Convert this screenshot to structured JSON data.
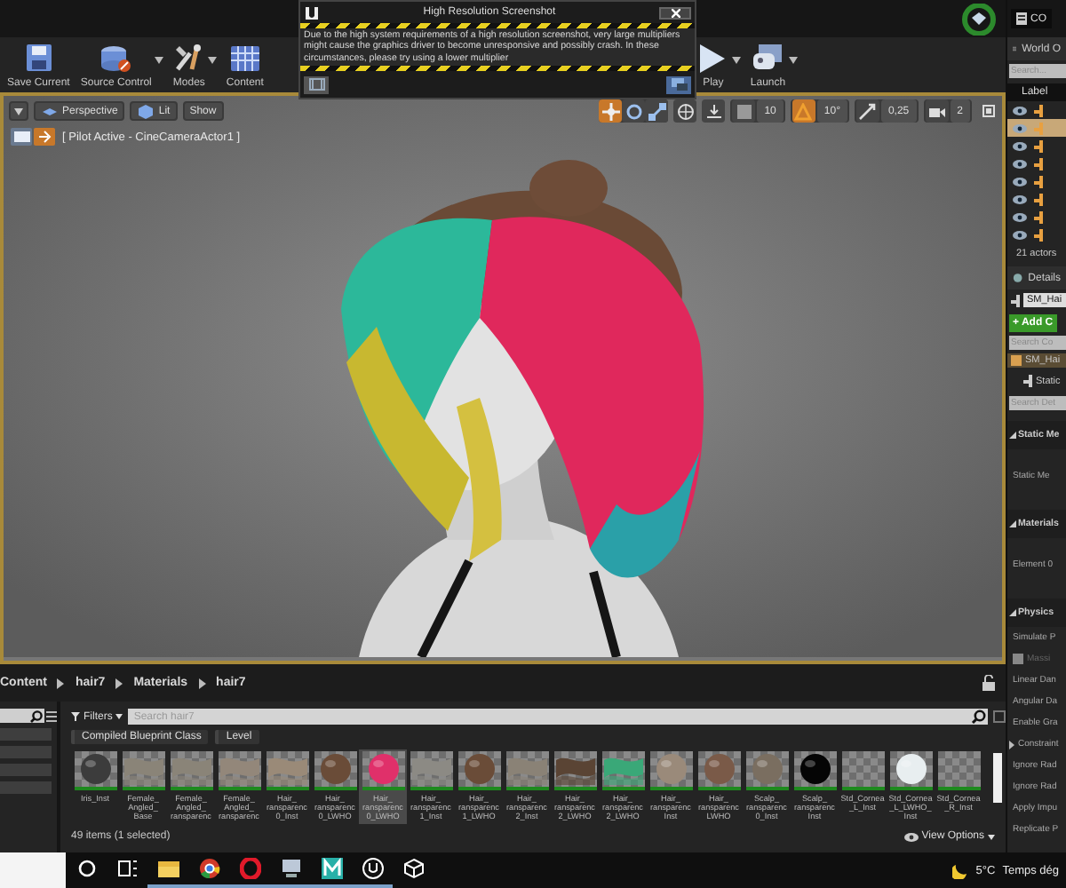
{
  "toolbar": {
    "buttons": [
      {
        "label": "Save Current",
        "kind": "save",
        "dropdown": false
      },
      {
        "label": "Source Control",
        "kind": "source",
        "dropdown": true
      },
      {
        "label": "Modes",
        "kind": "modes",
        "dropdown": true
      },
      {
        "label": "Content",
        "kind": "content",
        "dropdown": false
      },
      {
        "label": "Play",
        "kind": "play",
        "dropdown": true
      },
      {
        "label": "Launch",
        "kind": "launch",
        "dropdown": true
      }
    ]
  },
  "dialog": {
    "title": "High Resolution Screenshot",
    "message": "Due to the high system requirements of a high resolution screenshot, very large multipliers might cause the graphics driver to become unresponsive and possibly crash. In these circumstances, please try using a lower multiplier"
  },
  "viewport": {
    "view_buttons": [
      {
        "label": "Perspective",
        "kind": "perspective"
      },
      {
        "label": "Lit",
        "kind": "lit"
      },
      {
        "label": "Show",
        "kind": "plain"
      }
    ],
    "pilot_label": "[ Pilot Active - CineCameraActor1 ]",
    "transform_tools": [
      {
        "kind": "translate",
        "selected": true
      },
      {
        "kind": "rotate",
        "selected": false
      },
      {
        "kind": "scale",
        "selected": false
      }
    ],
    "snaps": [
      {
        "kind": "grid",
        "value": "10",
        "active": false
      },
      {
        "kind": "rotation",
        "value": "10°",
        "active": true
      },
      {
        "kind": "scale",
        "value": "0,25",
        "active": false
      },
      {
        "kind": "speed",
        "value": "2",
        "active": false
      }
    ]
  },
  "right_panel": {
    "tab": "CO",
    "world_outliner": {
      "title": "World O",
      "search_placeholder": "Search...",
      "column": "Label",
      "rows": [
        {
          "selected": false
        },
        {
          "selected": true
        },
        {
          "selected": false
        },
        {
          "selected": false
        },
        {
          "selected": false
        },
        {
          "selected": false
        },
        {
          "selected": false
        },
        {
          "selected": false
        }
      ],
      "actor_count": "21 actors"
    },
    "details": {
      "title": "Details",
      "actor_name": "SM_Hai",
      "add_button": "+ Add C",
      "component_search_placeholder": "Search Co",
      "component": "SM_Hai",
      "sub_component": "Static",
      "search_placeholder": "Search Det",
      "sections": [
        {
          "title": "Static Me",
          "rows": [
            {
              "kind": "tall",
              "label": "Static Me"
            }
          ]
        },
        {
          "title": "Materials",
          "rows": [
            {
              "kind": "tall",
              "label": "Element 0"
            }
          ]
        },
        {
          "title": "Physics",
          "rows": [
            {
              "kind": "plain",
              "label": "Simulate P"
            },
            {
              "kind": "checkbox",
              "label": "Massi",
              "checked": false
            },
            {
              "kind": "plain",
              "label": "Linear Dan"
            },
            {
              "kind": "plain",
              "label": "Angular Da"
            },
            {
              "kind": "plain",
              "label": "Enable Gra"
            },
            {
              "kind": "group",
              "label": "Constraint"
            },
            {
              "kind": "plain",
              "label": "Ignore Rad"
            },
            {
              "kind": "plain",
              "label": "Ignore Rad"
            },
            {
              "kind": "plain",
              "label": "Apply Impu"
            },
            {
              "kind": "plain",
              "label": "Replicate P"
            }
          ]
        }
      ]
    }
  },
  "content_browser": {
    "breadcrumb": [
      "Content",
      "hair7",
      "Materials",
      "hair7"
    ],
    "filters_button": "Filters",
    "search_placeholder": "Search hair7",
    "filter_tags": [
      "Compiled Blueprint Class",
      "Level"
    ],
    "assets": [
      {
        "label": "Iris_Inst",
        "kind": "sphere",
        "color": "#3c3c3c",
        "selected": false
      },
      {
        "label": "Female_ Angled_ Base",
        "kind": "texture",
        "color": "#8a8478",
        "selected": false
      },
      {
        "label": "Female_ Angled_ ransparenc",
        "kind": "texture",
        "color": "#8a8478",
        "selected": false
      },
      {
        "label": "Female_ Angled_ ransparenc",
        "kind": "texture",
        "color": "#93877a",
        "selected": false
      },
      {
        "label": "Hair_ ransparenc 0_Inst",
        "kind": "texture",
        "color": "#9a8a78",
        "selected": false
      },
      {
        "label": "Hair_ ransparenc 0_LWHO",
        "kind": "sphere",
        "color": "#6a4c38",
        "selected": false
      },
      {
        "label": "Hair_ ransparenc 0_LWHO",
        "kind": "sphere",
        "color": "#e0306a",
        "selected": true
      },
      {
        "label": "Hair_ ransparenc 1_Inst",
        "kind": "texture",
        "color": "#8c8a84",
        "selected": false
      },
      {
        "label": "Hair_ ransparenc 1_LWHO",
        "kind": "sphere",
        "color": "#6a4c38",
        "selected": false
      },
      {
        "label": "Hair_ ransparenc 2_Inst",
        "kind": "texture",
        "color": "#8a8276",
        "selected": false
      },
      {
        "label": "Hair_ ransparenc 2_LWHO",
        "kind": "texture",
        "color": "#5a4434",
        "selected": false
      },
      {
        "label": "Hair_ ransparenc 2_LWHO",
        "kind": "texture",
        "color": "#3aa878",
        "selected": false
      },
      {
        "label": "Hair_ ransparenc Inst",
        "kind": "sphere",
        "color": "#9a8a7a",
        "selected": false
      },
      {
        "label": "Hair_ ransparenc LWHO",
        "kind": "sphere",
        "color": "#7a5a48",
        "selected": false
      },
      {
        "label": "Scalp_ ransparenc 0_Inst",
        "kind": "sphere",
        "color": "#7a6e60",
        "selected": false
      },
      {
        "label": "Scalp_ ransparenc Inst",
        "kind": "sphere",
        "color": "#050505",
        "selected": false
      },
      {
        "label": "Std_Cornea _L_Inst",
        "kind": "blank",
        "selected": false
      },
      {
        "label": "Std_Cornea _L_LWHO_ Inst",
        "kind": "sphere",
        "color": "#e8eef0",
        "selected": false
      },
      {
        "label": "Std_Cornea _R_Inst",
        "kind": "blank",
        "selected": false
      }
    ],
    "status": "49 items (1 selected)",
    "view_options": "View Options"
  },
  "taskbar": {
    "apps": [
      {
        "kind": "cortana",
        "active": false
      },
      {
        "kind": "taskview",
        "active": false
      },
      {
        "kind": "folder",
        "active": true
      },
      {
        "kind": "chrome",
        "active": true
      },
      {
        "kind": "opera",
        "active": true
      },
      {
        "kind": "computer",
        "active": true
      },
      {
        "kind": "m",
        "active": true
      },
      {
        "kind": "unreal",
        "active": true
      },
      {
        "kind": "cube",
        "active": false
      }
    ],
    "temperature": "5°C",
    "weather": "Temps dég"
  }
}
